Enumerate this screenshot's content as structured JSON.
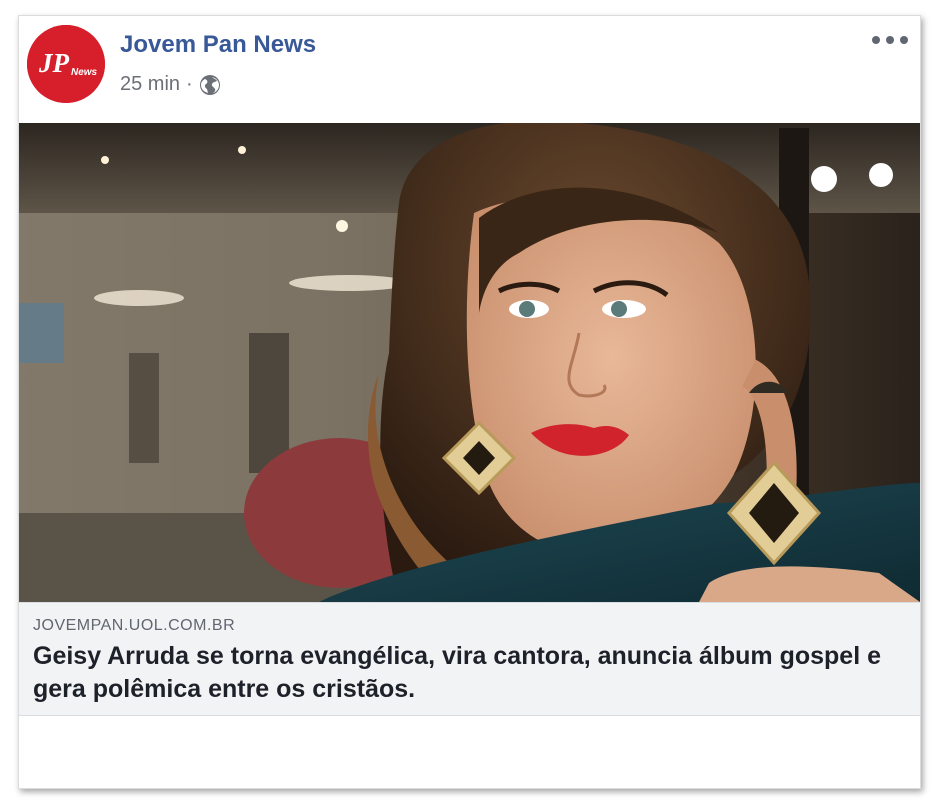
{
  "post": {
    "page_name": "Jovem Pan News",
    "time": "25 min",
    "separator": "·",
    "privacy_icon": "globe-icon",
    "more_icon": "more-options-icon",
    "avatar": {
      "text_main": "JP",
      "text_sub": "News",
      "color": "#d71f2b"
    }
  },
  "link_preview": {
    "domain": "JOVEMPAN.UOL.COM.BR",
    "headline": "Geisy Arruda se torna evangélica, vira cantora, anuncia álbum gospel e gera polêmica entre os cristãos."
  },
  "colors": {
    "page_name": "#385898",
    "meta_text": "#6b6f76",
    "link_background": "#f2f3f5",
    "headline": "#1d2129"
  }
}
